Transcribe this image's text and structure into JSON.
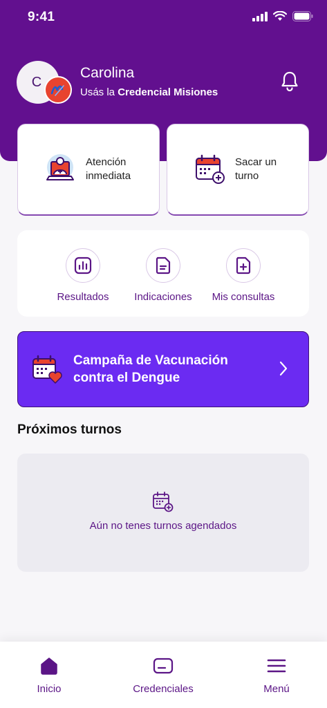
{
  "status_bar": {
    "time": "9:41"
  },
  "profile": {
    "avatar_letter": "C",
    "name": "Carolina",
    "credential_prefix": "Usás la",
    "credential_name": "Credencial Misiones"
  },
  "quick_actions": [
    {
      "label": "Atención inmediata",
      "icon": "doctor-laptop-icon"
    },
    {
      "label": "Sacar un turno",
      "icon": "calendar-add-icon"
    }
  ],
  "shortcuts": [
    {
      "label": "Resultados",
      "icon": "bar-chart-icon"
    },
    {
      "label": "Indicaciones",
      "icon": "document-lines-icon"
    },
    {
      "label": "Mis consultas",
      "icon": "document-plus-icon"
    }
  ],
  "campaign": {
    "title": "Campaña de Vacunación contra el Dengue",
    "icon": "calendar-heart-icon"
  },
  "upcoming": {
    "title": "Próximos turnos",
    "empty_text": "Aún no tenes turnos agendados"
  },
  "tabbar": [
    {
      "label": "Inicio",
      "icon": "home-icon"
    },
    {
      "label": "Credenciales",
      "icon": "card-icon"
    },
    {
      "label": "Menú",
      "icon": "menu-icon"
    }
  ],
  "colors": {
    "primary": "#62108f",
    "campaign": "#6b2bf2",
    "accent_red": "#e8432f",
    "text_purple": "#5b1586"
  }
}
